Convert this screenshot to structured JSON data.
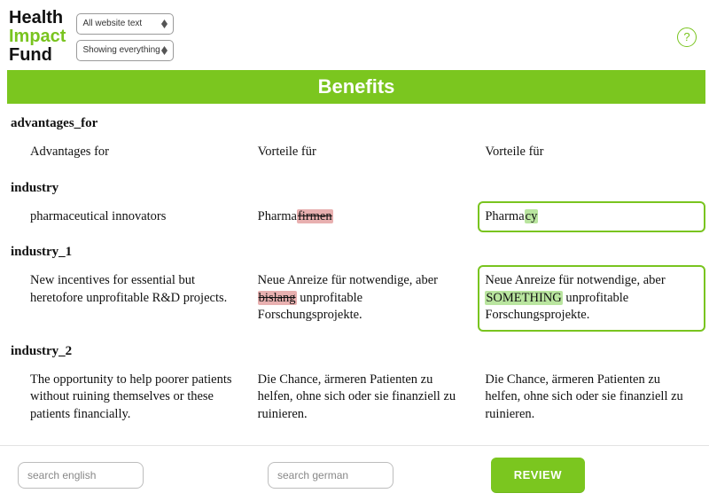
{
  "logo": {
    "l1": "Health",
    "l2": "Impact",
    "l3": "Fund"
  },
  "dropdowns": {
    "scope": "All website text",
    "filter": "Showing everything"
  },
  "help_label": "?",
  "section_title": "Benefits",
  "entries": [
    {
      "key": "advantages_for",
      "source": "Advantages for",
      "original": "Vorteile für",
      "edited": "Vorteile für",
      "has_diff": false,
      "edited_box": false
    },
    {
      "key": "industry",
      "source": "pharmaceutical innovators",
      "original_pre": "Pharma",
      "original_strike": "firmen",
      "original_post": "",
      "edited_pre": "Pharma",
      "edited_hl": "cy",
      "edited_post": "",
      "has_diff": true,
      "edited_box": true
    },
    {
      "key": "industry_1",
      "source": "New incentives for essential but heretofore unprofitable R&D projects.",
      "original_pre": "Neue Anreize für notwendige, aber ",
      "original_strike": "bislang",
      "original_post": " unprofitable Forschungsprojekte.",
      "edited_pre": "Neue Anreize für notwendige, aber ",
      "edited_hl": "SOMETHING",
      "edited_post": " unprofitable Forschungsprojekte.",
      "has_diff": true,
      "edited_box": true
    },
    {
      "key": "industry_2",
      "source": "The opportunity to help poorer patients without ruining themselves or these patients financially.",
      "original": "Die Chance, ärmeren Patienten zu helfen, ohne sich oder sie finanziell zu ruinieren.",
      "edited": "Die Chance, ärmeren Patienten zu helfen, ohne sich oder sie finanziell zu ruinieren.",
      "has_diff": false,
      "edited_box": false
    }
  ],
  "search": {
    "en_placeholder": "search english",
    "de_placeholder": "search german"
  },
  "review_label": "REVIEW"
}
